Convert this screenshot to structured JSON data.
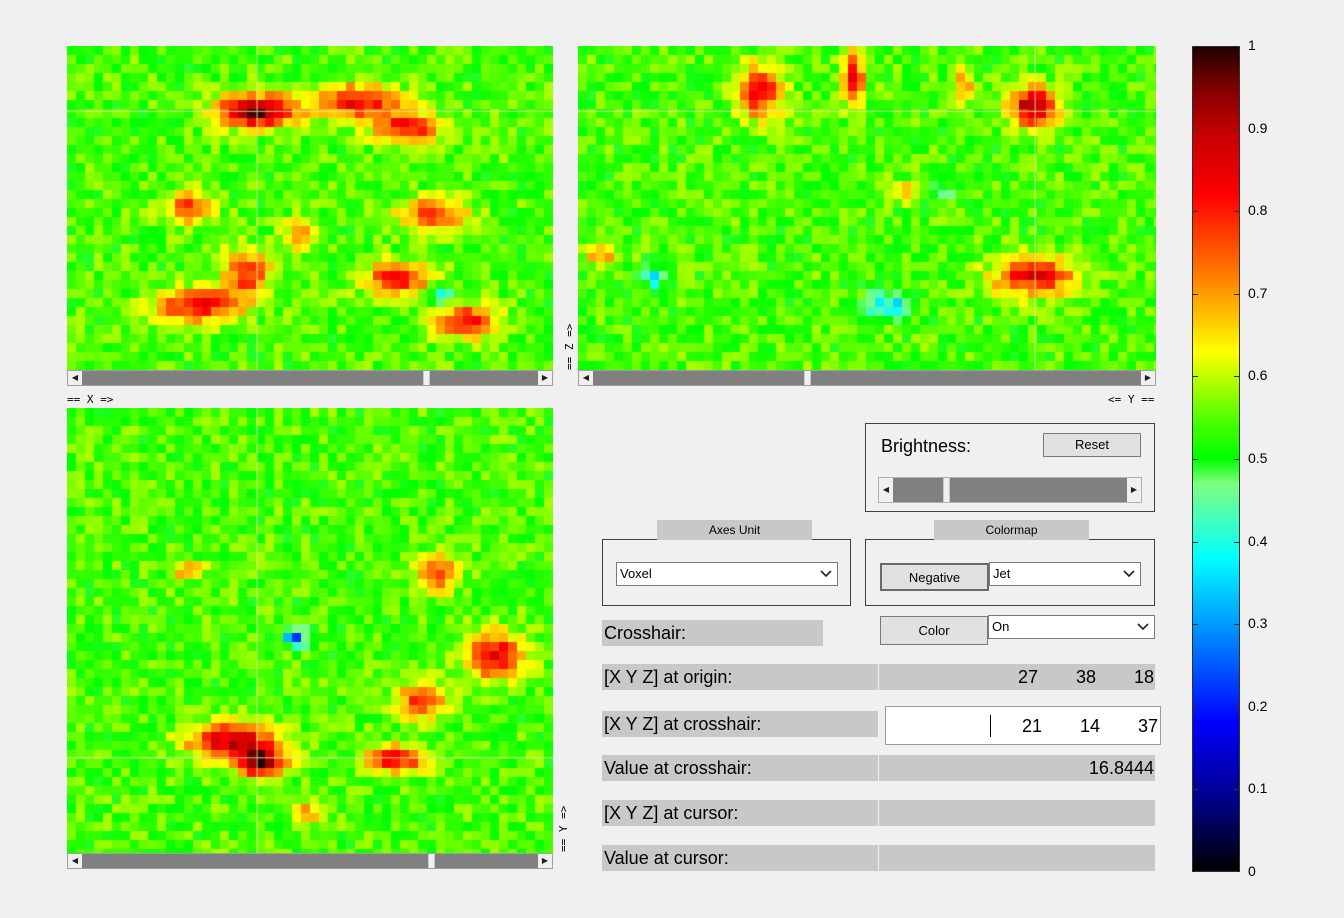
{
  "views": {
    "axial": {
      "name": "axial-view"
    },
    "sagittal": {
      "name": "sagittal-view"
    },
    "coronal": {
      "name": "coronal-view"
    }
  },
  "axis_labels": {
    "x": "== X =>",
    "z": "== Z =>",
    "y_reversed": "<= Y ==",
    "y": "== Y =>"
  },
  "brightness": {
    "label": "Brightness:",
    "reset_label": "Reset",
    "value_fraction": 0.22
  },
  "axes_unit": {
    "title": "Axes Unit",
    "selected": "Voxel"
  },
  "colormap": {
    "title": "Colormap",
    "negative_label": "Negative",
    "selected": "Jet"
  },
  "crosshair": {
    "label": "Crosshair:",
    "color_label": "Color",
    "selected": "On"
  },
  "origin": {
    "label": "[X Y Z] at origin:",
    "x": "27",
    "y": "38",
    "z": "18"
  },
  "crosshair_pos": {
    "label": "[X Y Z] at crosshair:",
    "x": "21",
    "y": "14",
    "z": "37"
  },
  "value_crosshair": {
    "label": "Value at crosshair:",
    "value": "16.8444"
  },
  "cursor_pos": {
    "label": "[X Y Z] at cursor:",
    "value": ""
  },
  "value_cursor": {
    "label": "Value at cursor:",
    "value": ""
  },
  "colorbar": {
    "ticks": [
      "0",
      "0.1",
      "0.2",
      "0.3",
      "0.4",
      "0.5",
      "0.6",
      "0.7",
      "0.8",
      "0.9",
      "1"
    ]
  },
  "scroll_positions": {
    "axial": 0.76,
    "sagittal": 0.39,
    "coronal": 0.77
  }
}
